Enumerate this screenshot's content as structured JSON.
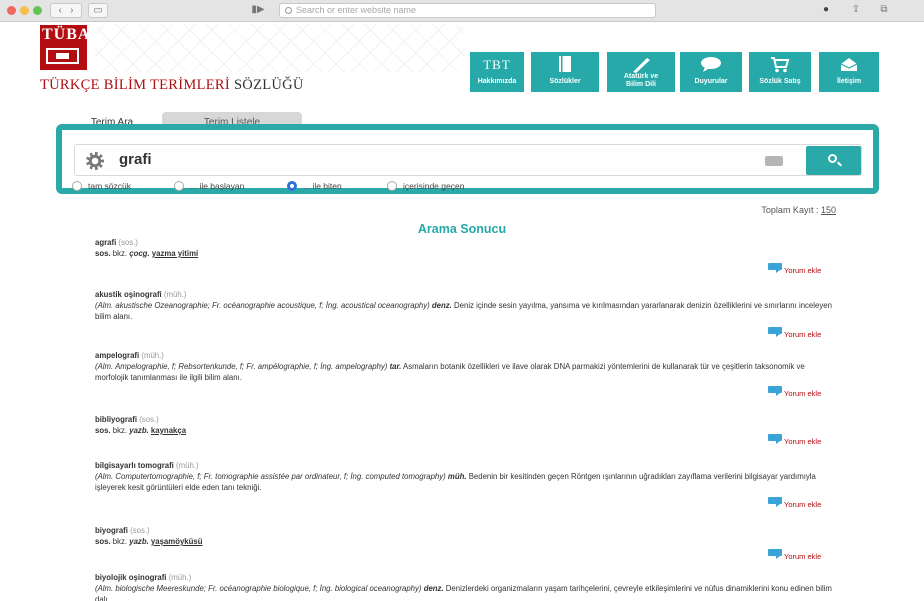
{
  "browser": {
    "address_placeholder": "Search or enter website name"
  },
  "site": {
    "logo_text": "TÜBA",
    "title_red": "TÜRKÇE BİLİM TERİMLERİ",
    "title_dark": "SÖZLÜĞÜ"
  },
  "nav": [
    {
      "label": "Hakkımızda",
      "icon": "tbt-icon"
    },
    {
      "label": "Sözlükler",
      "icon": "book-icon"
    },
    {
      "label": "Atatürk ve Bilim Dili",
      "icon": "pen-icon"
    },
    {
      "label": "Duyurular",
      "icon": "chat-icon"
    },
    {
      "label": "Sözlük Satış",
      "icon": "cart-icon"
    },
    {
      "label": "İletişim",
      "icon": "mail-icon"
    }
  ],
  "tbt_logo": "TBT",
  "tabs": {
    "active": "Terim Ara",
    "inactive": "Terim Listele"
  },
  "search": {
    "query": "grafi",
    "options": [
      {
        "label": "tam sözcük",
        "selected": false
      },
      {
        "label": "... ile başlayan",
        "selected": false
      },
      {
        "label": "... ile biten",
        "selected": true
      },
      {
        "label": "içerisinde geçen",
        "selected": false
      }
    ]
  },
  "results": {
    "total_label": "Toplam Kayıt :",
    "total_count": "150",
    "title": "Arama Sonucu",
    "comment_label": "Yorum ekle"
  },
  "entries": [
    {
      "term": "agrafi",
      "abbr": "(sos.)",
      "def_html": "<b>sos.</b> bkz. <b><i>çocg.</i></b> <u>yazma yitimi</u>"
    },
    {
      "term": "akustik oşinografi",
      "abbr": "(müh.)",
      "def_html": "<i>(Alm. akustische Ozeanographie; Fr. océanographie acoustique, f; İng. acoustical oceanography)</i> <b><i>denz.</i></b> Deniz içinde sesin yayılma, yansıma ve kırılmasından yararlanarak denizin özelliklerini ve sınırlarını inceleyen bilim alanı."
    },
    {
      "term": "ampelografi",
      "abbr": "(müh.)",
      "def_html": "<i>(Alm. Ampelographie, f; Rebsortenkunde, f; Fr. ampélographie, f; İng. ampelography)</i> <b><i>tar.</i></b> Asmaların botanik özellikleri ve ilave olarak DNA parmakizi yöntemlerini de kullanarak tür ve çeşitlerin taksonomik ve morfolojik tanımlanması ile ilgili bilim alanı."
    },
    {
      "term": "bibliyografi",
      "abbr": "(sos.)",
      "def_html": "<b>sos.</b> bkz. <b><i>yazb.</i></b> <u>kaynakça</u>"
    },
    {
      "term": "bilgisayarlı tomografi",
      "abbr": "(müh.)",
      "def_html": "<i>(Alm. Computertomographie, f; Fr. tomographie assistée par ordinateur, f; İng. computed tomography)</i> <b><i>müh.</i></b> Bedenin bir kesitinden geçen Röntgen ışınlarının uğradıkları zayıflama verilerini bilgisayar yardımıyla işleyerek kesit görüntüleri elde eden tanı tekniği."
    },
    {
      "term": "biyografi",
      "abbr": "(sos.)",
      "def_html": "<b>sos.</b> bkz. <b><i>yazb.</i></b> <u>yaşamöyküsü</u>"
    },
    {
      "term": "biyolojik oşinografi",
      "abbr": "(müh.)",
      "def_html": "<i>(Alm. biologische Meereskunde; Fr. océanographie biologique, f; İng. biological oceanography)</i> <b><i>denz.</i></b> Denizlerdeki organizmaların yaşam tarihçelerini, çevreyle etkileşimlerini ve nüfus dinamiklerini konu edinen bilim dalı."
    }
  ]
}
